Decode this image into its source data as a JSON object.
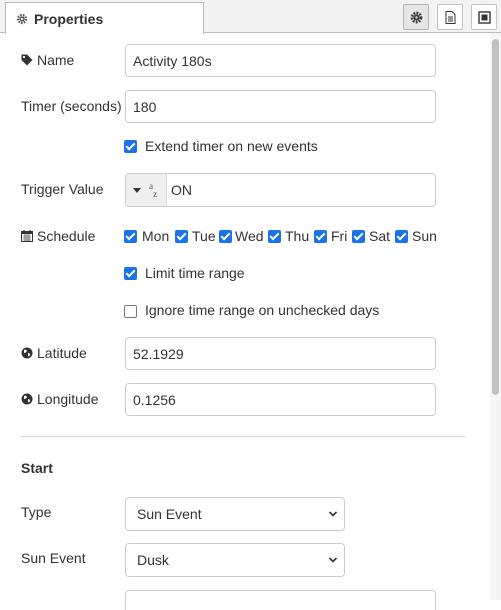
{
  "tabs": {
    "properties_label": "Properties"
  },
  "form": {
    "name_label": "Name",
    "name_value": "Activity 180s",
    "timer_label": "Timer (seconds)",
    "timer_value": "180",
    "extend_label": "Extend timer on new events",
    "extend_checked": true,
    "trigger_label": "Trigger Value",
    "trigger_type": "az",
    "trigger_value": "ON",
    "schedule_label": "Schedule",
    "days": [
      {
        "label": "Mon",
        "checked": true
      },
      {
        "label": "Tue",
        "checked": true
      },
      {
        "label": "Wed",
        "checked": true
      },
      {
        "label": "Thu",
        "checked": true
      },
      {
        "label": "Fri",
        "checked": true
      },
      {
        "label": "Sat",
        "checked": true
      },
      {
        "label": "Sun",
        "checked": true
      }
    ],
    "limit_label": "Limit time range",
    "limit_checked": true,
    "ignore_label": "Ignore time range on unchecked days",
    "ignore_checked": false,
    "latitude_label": "Latitude",
    "latitude_value": "52.1929",
    "longitude_label": "Longitude",
    "longitude_value": "0.1256"
  },
  "start": {
    "heading": "Start",
    "type_label": "Type",
    "type_value": "Sun Event",
    "sun_event_label": "Sun Event",
    "sun_event_value": "Dusk"
  },
  "colors": {
    "accent": "#1a73e8"
  }
}
